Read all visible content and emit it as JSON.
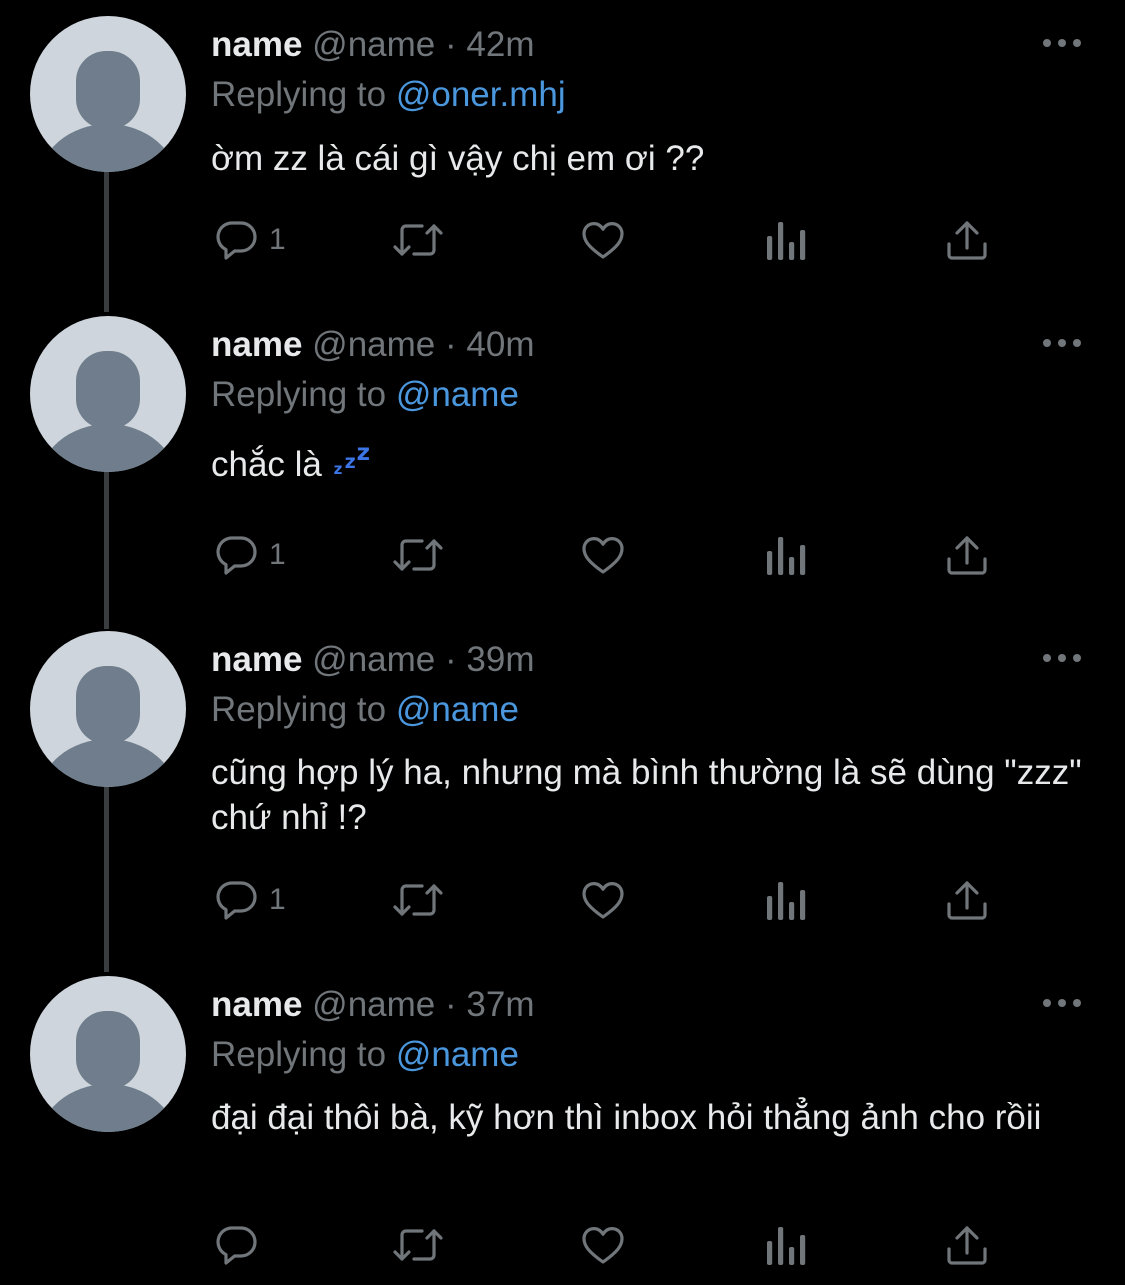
{
  "tweets": [
    {
      "name": "name",
      "handle": "@name",
      "separator": "·",
      "time": "42m",
      "replying_label": "Replying to",
      "replying_to": "@oner.mhj",
      "text": "ờm zz là cái gì vậy chị em ơi ??",
      "reply_count": "1"
    },
    {
      "name": "name",
      "handle": "@name",
      "separator": "·",
      "time": "40m",
      "replying_label": "Replying to",
      "replying_to": "@name",
      "text": "chắc là",
      "emoji": "zzz-sleeping-emoji",
      "reply_count": "1"
    },
    {
      "name": "name",
      "handle": "@name",
      "separator": "·",
      "time": "39m",
      "replying_label": "Replying to",
      "replying_to": "@name",
      "text": "cũng hợp lý ha, nhưng mà bình thường là sẽ dùng \"zzz\" chứ nhỉ !?",
      "reply_count": "1"
    },
    {
      "name": "name",
      "handle": "@name",
      "separator": "·",
      "time": "37m",
      "replying_label": "Replying to",
      "replying_to": "@name",
      "text": "đại đại thôi bà, kỹ hơn thì inbox hỏi thẳng ảnh cho rồii",
      "reply_count": ""
    }
  ],
  "icons": {
    "more": "more-horizontal-icon",
    "reply": "reply-bubble-icon",
    "retweet": "retweet-icon",
    "like": "heart-icon",
    "views": "analytics-bars-icon",
    "share": "share-upload-icon"
  },
  "colors": {
    "background": "#000000",
    "primary_text": "#e7e9ea",
    "secondary_text": "#71767b",
    "link": "#4a97de",
    "thread_line": "#3a3d40",
    "avatar_bg": "#ced5dc",
    "avatar_fg": "#6f7d8c"
  }
}
